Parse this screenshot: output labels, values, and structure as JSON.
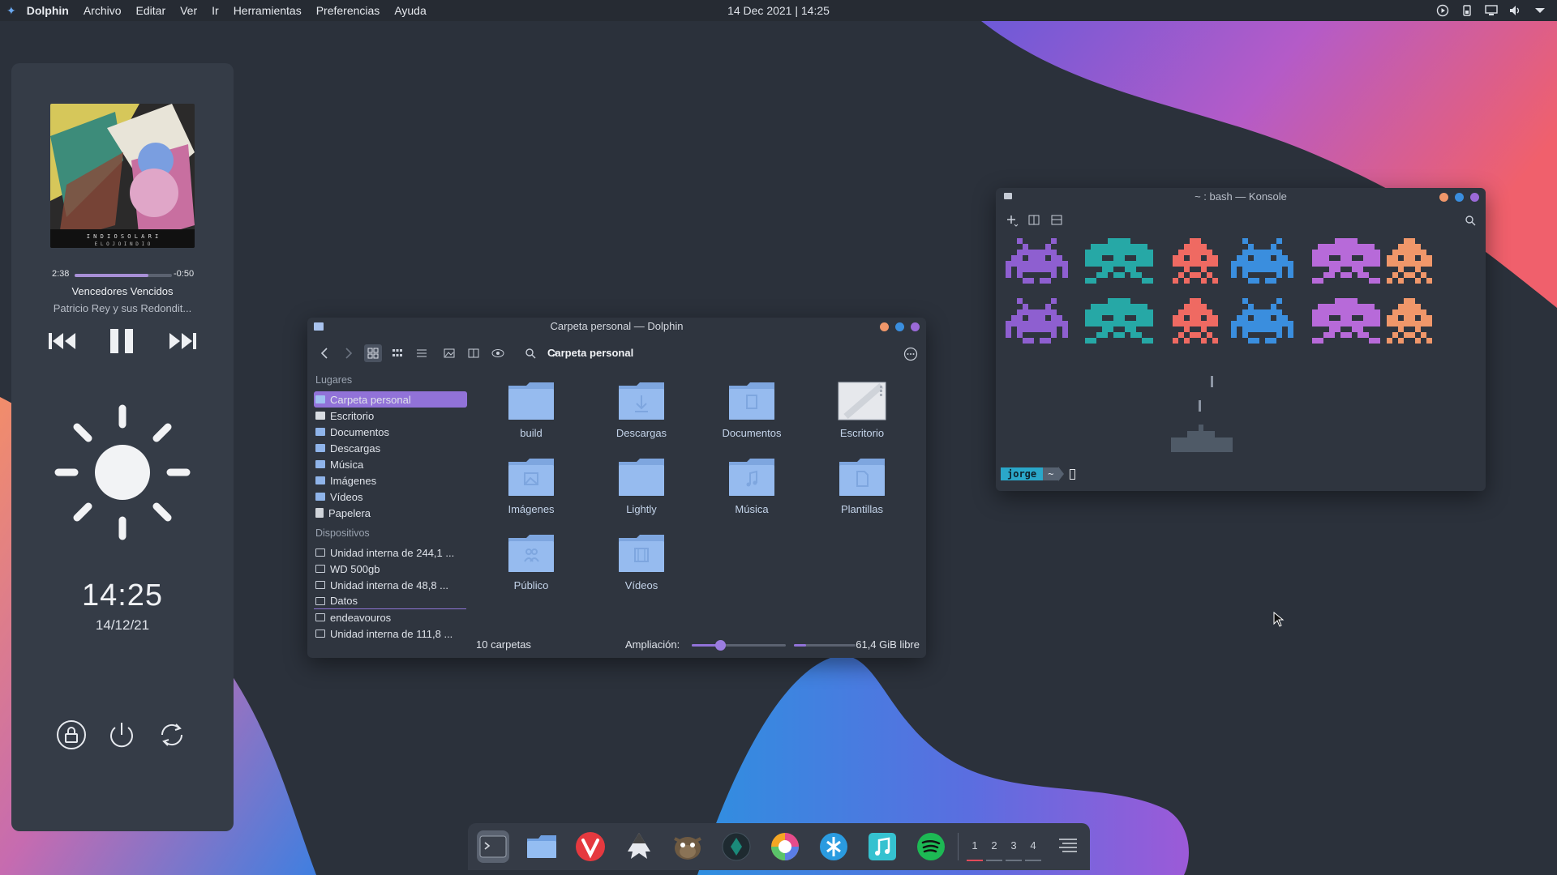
{
  "topbar": {
    "app_name": "Dolphin",
    "menu": [
      "Archivo",
      "Editar",
      "Ver",
      "Ir",
      "Herramientas",
      "Preferencias",
      "Ayuda"
    ],
    "clock": "14 Dec 2021 | 14:25",
    "tray_icons": [
      "media-play-icon",
      "battery-icon",
      "network-icon",
      "volume-icon",
      "chevron-down-icon"
    ]
  },
  "player": {
    "elapsed": "2:38",
    "remaining": "-0:50",
    "progress": 0.76,
    "title": "Vencedores Vencidos",
    "artist": "Patricio Rey y sus Redondit..."
  },
  "widget": {
    "time": "14:25",
    "date": "14/12/21",
    "weather_icon": "sun-icon",
    "buttons": [
      "lock-icon",
      "power-icon",
      "restart-icon"
    ]
  },
  "dolphin": {
    "title": "Carpeta personal — Dolphin",
    "breadcrumb": "Carpeta personal",
    "places_heading": "Lugares",
    "places": [
      "Carpeta personal",
      "Escritorio",
      "Documentos",
      "Descargas",
      "Música",
      "Imágenes",
      "Vídeos",
      "Papelera"
    ],
    "devices_heading": "Dispositivos",
    "devices": [
      "Unidad interna de 244,1 ...",
      "WD 500gb",
      "Unidad interna de 48,8 ...",
      "Datos",
      "endeavouros",
      "Unidad interna de 111,8 ..."
    ],
    "folders": [
      "build",
      "Descargas",
      "Documentos",
      "Escritorio",
      "Imágenes",
      "Lightly",
      "Música",
      "Plantillas",
      "Público",
      "Vídeos"
    ],
    "status_count": "10 carpetas",
    "zoom_label": "Ampliación:",
    "zoom_level": 0.3,
    "free_space": "61,4 GiB libre",
    "colors": {
      "accent": "#9172d8",
      "folder": "#8fb4ea"
    }
  },
  "konsole": {
    "title": "~ : bash — Konsole",
    "prompt_user": "jorge",
    "prompt_dir": "~",
    "invader_colors": [
      "#8e5fd0",
      "#26a8a6",
      "#ef6a62",
      "#3a8ede",
      "#b76ad9",
      "#f0976a"
    ]
  },
  "dock": {
    "apps": [
      "terminal-icon",
      "files-icon",
      "vivaldi-icon",
      "inkscape-icon",
      "gimp-icon",
      "kleopatra-icon",
      "color-picker-icon",
      "kdeconnect-icon",
      "music-icon",
      "spotify-icon"
    ],
    "workspaces": [
      "1",
      "2",
      "3",
      "4"
    ]
  }
}
